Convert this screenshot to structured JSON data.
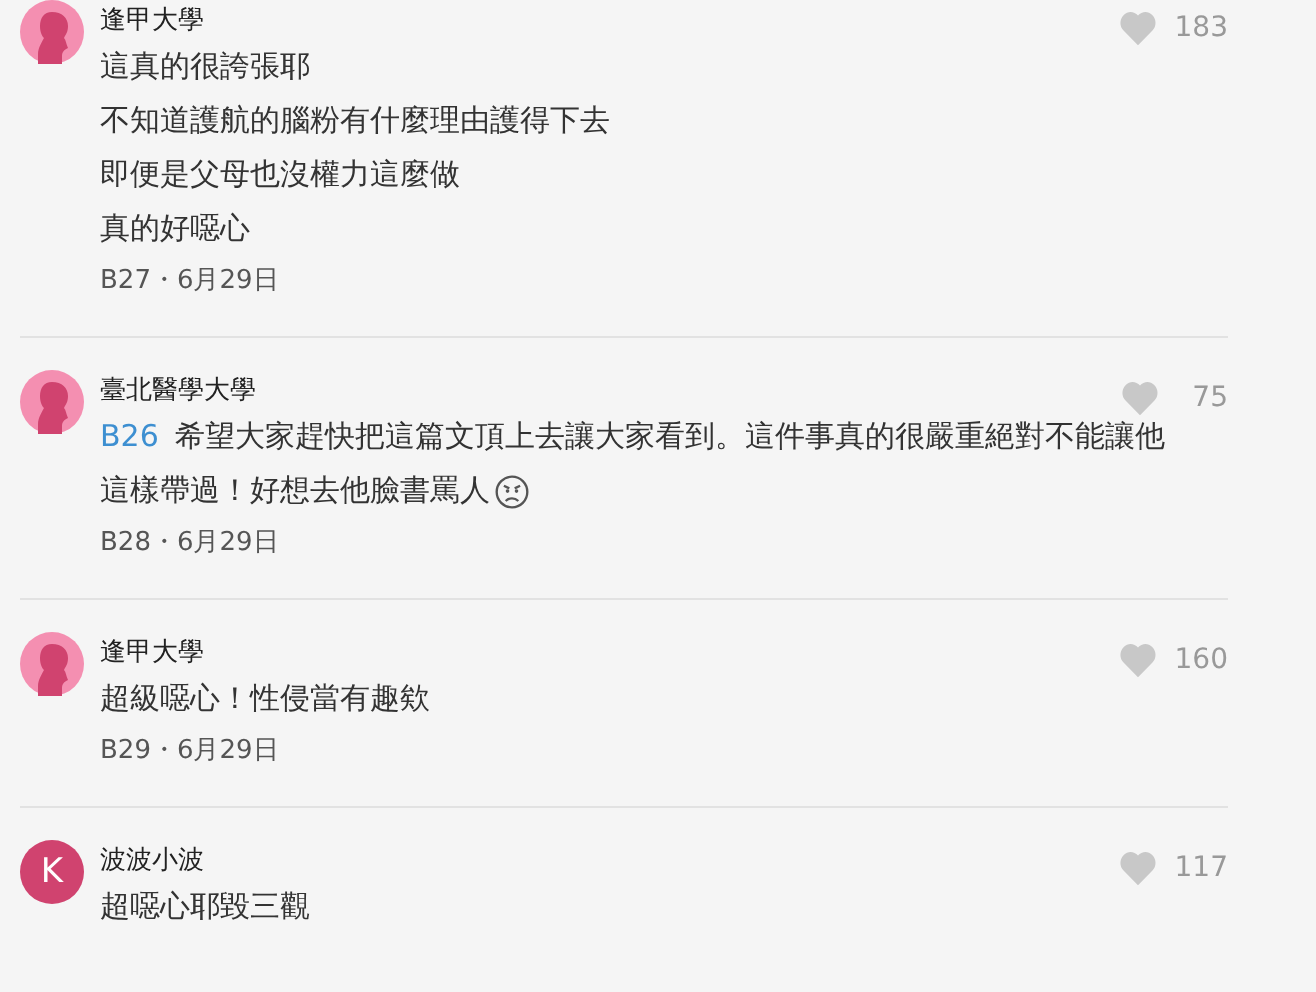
{
  "comments": [
    {
      "author": "逢甲大學",
      "avatar": {
        "kind": "silhouette"
      },
      "likes": "183",
      "liked": false,
      "lines": [
        "這真的很誇張耶",
        "不知道護航的腦粉有什麼理由護得下去",
        "即便是父母也沒權力這麼做",
        "真的好噁心"
      ],
      "meta": "B27・6月29日"
    },
    {
      "author": "臺北醫學大學",
      "avatar": {
        "kind": "silhouette"
      },
      "likes": "75",
      "liked": false,
      "reply_to": "B26",
      "lines": [
        "希望大家趕快把這篇文頂上去讓大家看到。這件事真的很嚴重絕對不能讓他",
        "這樣帶過！好想去他臉書罵人"
      ],
      "angry_face": true,
      "meta": "B28・6月29日"
    },
    {
      "author": "逢甲大學",
      "avatar": {
        "kind": "silhouette"
      },
      "likes": "160",
      "liked": false,
      "lines": [
        "超級噁心！性侵當有趣欸"
      ],
      "meta": "B29・6月29日"
    },
    {
      "author": "波波小波",
      "avatar": {
        "kind": "letter",
        "letter": "K"
      },
      "likes": "117",
      "liked": false,
      "lines": [
        "超噁心耶毀三觀"
      ]
    }
  ]
}
